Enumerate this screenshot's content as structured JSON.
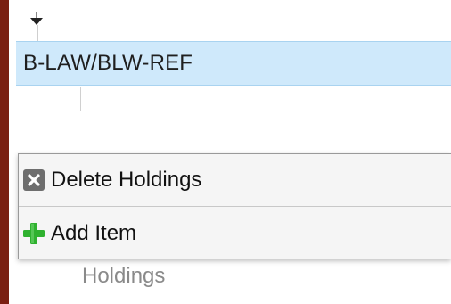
{
  "tree": {
    "selected_node_label": "B-LAW/BLW-REF",
    "background_row_label": "Holdings"
  },
  "context_menu": {
    "items": [
      {
        "label": "Delete Holdings",
        "icon": "close-x-icon"
      },
      {
        "label": "Add Item",
        "icon": "plus-icon"
      }
    ]
  },
  "colors": {
    "left_border": "#7a1f12",
    "selection_bg": "#cfe9fb",
    "menu_bg": "#f5f5f5",
    "delete_icon_bg": "#6e6e6e",
    "add_icon": "#2fb12f"
  }
}
